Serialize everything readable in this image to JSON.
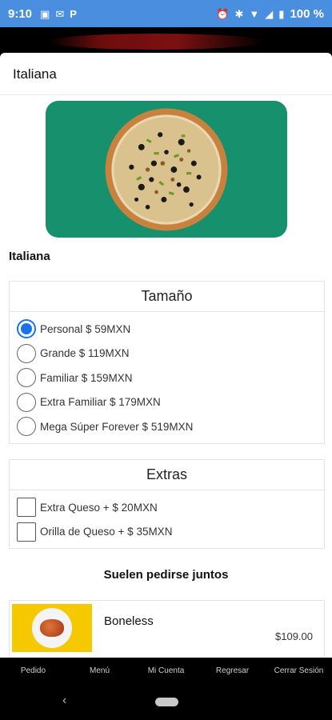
{
  "status_bar": {
    "time": "9:10",
    "battery": "100 %",
    "left_icons": [
      "image-icon",
      "mail-icon",
      "p-icon"
    ],
    "right_icons": [
      "alarm-icon",
      "bluetooth-icon",
      "wifi-icon",
      "signal-icon",
      "battery-icon"
    ]
  },
  "modal": {
    "title": "Italiana",
    "product_name": "Italiana",
    "image_bg_color": "#17906d"
  },
  "size_section": {
    "title": "Tamaño",
    "options": [
      {
        "label": "Personal $ 59MXN",
        "selected": true
      },
      {
        "label": "Grande $ 119MXN",
        "selected": false
      },
      {
        "label": "Familiar $ 159MXN",
        "selected": false
      },
      {
        "label": "Extra Familiar $ 179MXN",
        "selected": false
      },
      {
        "label": "Mega Súper Forever $ 519MXN",
        "selected": false
      }
    ]
  },
  "extras_section": {
    "title": "Extras",
    "options": [
      {
        "label": "Extra Queso + $ 20MXN",
        "checked": false
      },
      {
        "label": "Orilla de Queso + $ 35MXN",
        "checked": false
      }
    ]
  },
  "related": {
    "title": "Suelen pedirse juntos",
    "items": [
      {
        "name": "Boneless",
        "price": "$109.00",
        "thumb_bg_color": "#f5c800"
      }
    ]
  },
  "bottom_nav": {
    "items": [
      "Pedido",
      "Menú",
      "Mi Cuenta",
      "Regresar",
      "Cerrar Sesión"
    ]
  },
  "colors": {
    "status_bar": "#4a8ee0",
    "accent": "#1a73e8"
  }
}
